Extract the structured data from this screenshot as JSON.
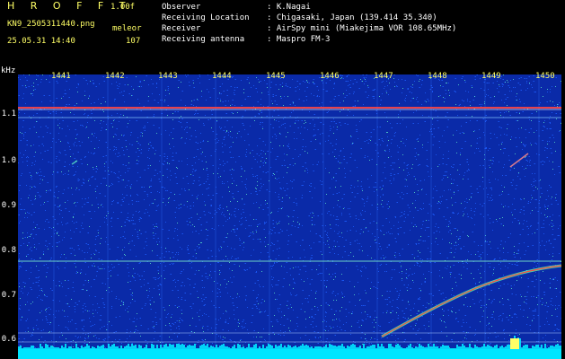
{
  "header": {
    "brand": "H R O F F T",
    "version": "1.00f",
    "filename": "KN9_2505311440.png",
    "mode": "meleor",
    "datetime": "25.05.31 14:40",
    "count": "107"
  },
  "metadata": [
    {
      "label": "Observer",
      "value": ": K.Nagai"
    },
    {
      "label": "Receiving Location",
      "value": ": Chigasaki, Japan (139.414 35.340)"
    },
    {
      "label": "Receiver",
      "value": ": AirSpy mini (Miakejima VOR 108.65MHz)"
    },
    {
      "label": "Receiving antenna",
      "value": ": Maspro FM-3"
    }
  ],
  "spectrogram": {
    "y_unit": "kHz",
    "y_ticks": [
      "1.1",
      "1.0",
      "0.9",
      "0.8",
      "0.7",
      "0.6"
    ],
    "x_ticks": [
      "1441",
      "1442",
      "1443",
      "1444",
      "1445",
      "1446",
      "1447",
      "1448",
      "1449",
      "1450"
    ],
    "colors": {
      "background": "#0a2aa8",
      "noise": "#1e5fff",
      "carrier": "#ff4444",
      "trace": "#55ffaa",
      "floor": "#00e5ff",
      "label_yellow": "#ffff66"
    }
  }
}
